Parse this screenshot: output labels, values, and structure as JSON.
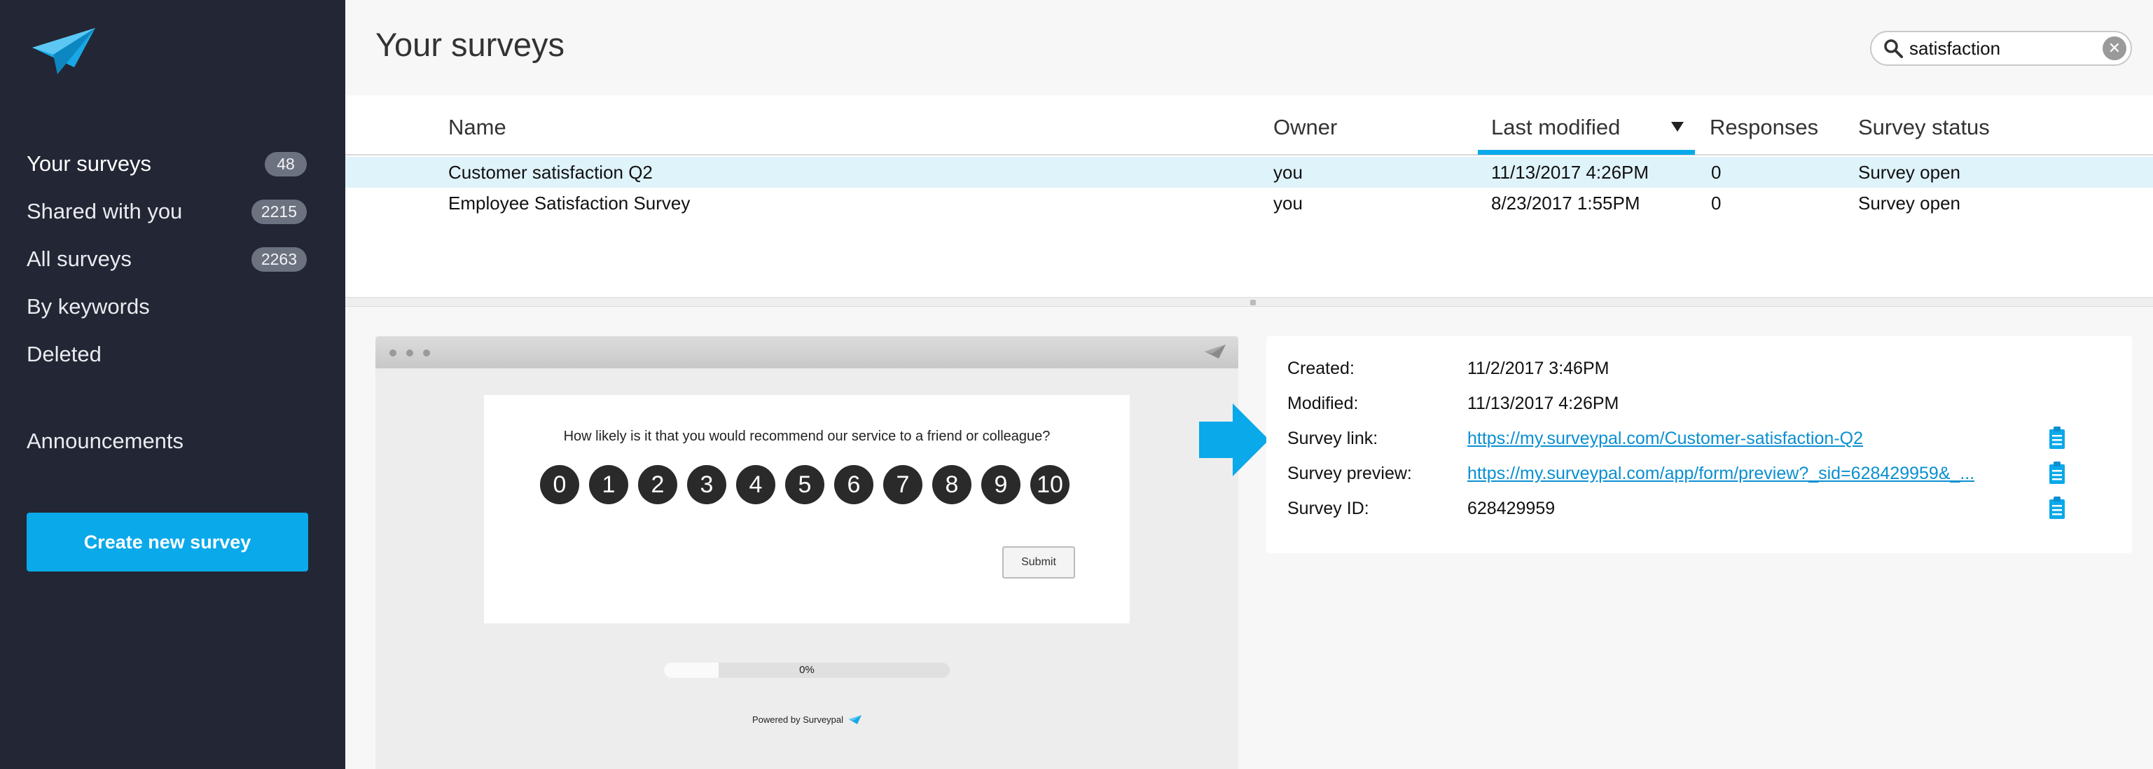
{
  "sidebar": {
    "items": [
      {
        "label": "Your surveys",
        "count": "48"
      },
      {
        "label": "Shared with you",
        "count": "2215"
      },
      {
        "label": "All surveys",
        "count": "2263"
      },
      {
        "label": "By keywords"
      },
      {
        "label": "Deleted"
      }
    ],
    "announcements": "Announcements",
    "create_button": "Create new survey"
  },
  "header": {
    "title": "Your surveys",
    "search_value": "satisfaction"
  },
  "table": {
    "columns": [
      "Name",
      "Owner",
      "Last modified",
      "Responses",
      "Survey status"
    ],
    "sort_column": "Last modified",
    "rows": [
      {
        "name": "Customer satisfaction Q2",
        "owner": "you",
        "modified": "11/13/2017 4:26PM",
        "responses": "0",
        "status": "Survey open",
        "selected": true
      },
      {
        "name": "Employee Satisfaction Survey",
        "owner": "you",
        "modified": "8/23/2017 1:55PM",
        "responses": "0",
        "status": "Survey open",
        "selected": false
      }
    ]
  },
  "preview": {
    "question": "How likely is it that you would recommend our service to a friend or colleague?",
    "scale": [
      "0",
      "1",
      "2",
      "3",
      "4",
      "5",
      "6",
      "7",
      "8",
      "9",
      "10"
    ],
    "submit": "Submit",
    "progress_label": "0%",
    "progress_fraction": 0.19,
    "powered_by": "Powered by Surveypal"
  },
  "details": {
    "created_label": "Created:",
    "created": "11/2/2017 3:46PM",
    "modified_label": "Modified:",
    "modified": "11/13/2017 4:26PM",
    "link_label": "Survey link:",
    "link": "https://my.surveypal.com/Customer-satisfaction-Q2",
    "preview_label": "Survey preview:",
    "preview_link": "https://my.surveypal.com/app/form/preview?_sid=628429959&_...",
    "id_label": "Survey ID:",
    "id": "628429959"
  },
  "colors": {
    "accent": "#0aa9ea",
    "sidebar_bg": "#232634",
    "selected_row": "#dff3fb",
    "link": "#0a8fd1"
  },
  "icons": [
    "paper-plane-logo-icon",
    "search-icon",
    "clear-icon",
    "clipboard-icon",
    "arrow-right-icon"
  ]
}
